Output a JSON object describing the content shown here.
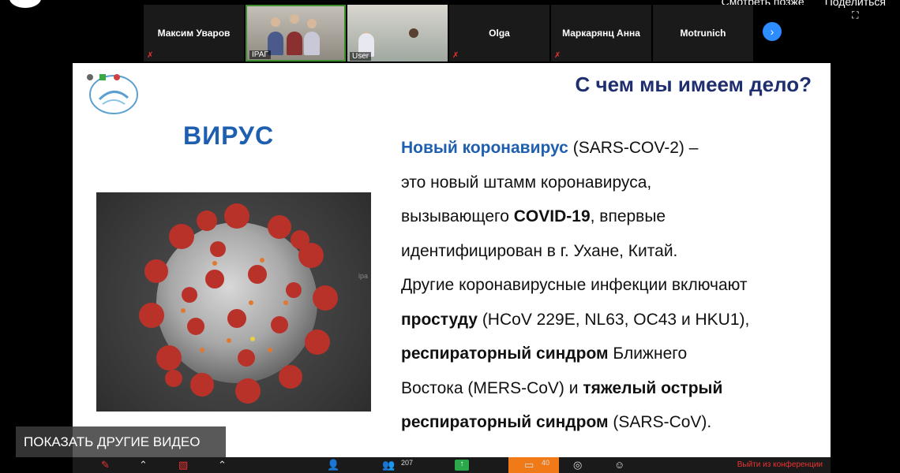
{
  "youtube": {
    "watch_later": "Смотреть позже",
    "share": "Поделиться"
  },
  "participants": [
    {
      "name": "Максим Уваров",
      "muted": true
    },
    {
      "name": "IPAГ",
      "video": true
    },
    {
      "name": "User",
      "video": true
    },
    {
      "name": "Olga",
      "muted": true
    },
    {
      "name": "Маркарянц Анна",
      "muted": true
    },
    {
      "name": "Motrunich",
      "muted": false
    }
  ],
  "slide": {
    "title": "С чем мы имеем дело?",
    "virus_label": "ВИРУС",
    "side_text": "ipa",
    "body": {
      "l1_blue": "Новый коронавирус",
      "l1_rest": " (SARS-COV-2) –",
      "l2": "это новый штамм коронавируса,",
      "l3_pre": "вызывающего ",
      "l3_bold": "COVID-19",
      "l3_rest": ", впервые",
      "l4": "идентифицирован в г. Ухане, Китай.",
      "l5": "Другие коронавирусные инфекции включают",
      "l6_bold": "простуду",
      "l6_rest": " (HCoV 229E, NL63, OC43 и HKU1),",
      "l7_bold": "респираторный синдром",
      "l7_rest": " Ближнего",
      "l8_pre": "Востока (MERS-CoV) и ",
      "l8_bold": "тяжелый острый",
      "l9_bold": "респираторный синдром",
      "l9_rest": " (SARS-CoV)."
    }
  },
  "overlay": {
    "show_other_videos": "ПОКАЗАТЬ ДРУГИЕ ВИДЕО"
  },
  "toolbar": {
    "participants_count": "207",
    "chat_count": "40",
    "leave_label": "Выйти из конференции"
  },
  "colors": {
    "slide_title": "#1f2e6e",
    "accent_blue": "#1f5fb0",
    "zoom_blue": "#2d8cff",
    "chat_orange": "#f07a18"
  }
}
